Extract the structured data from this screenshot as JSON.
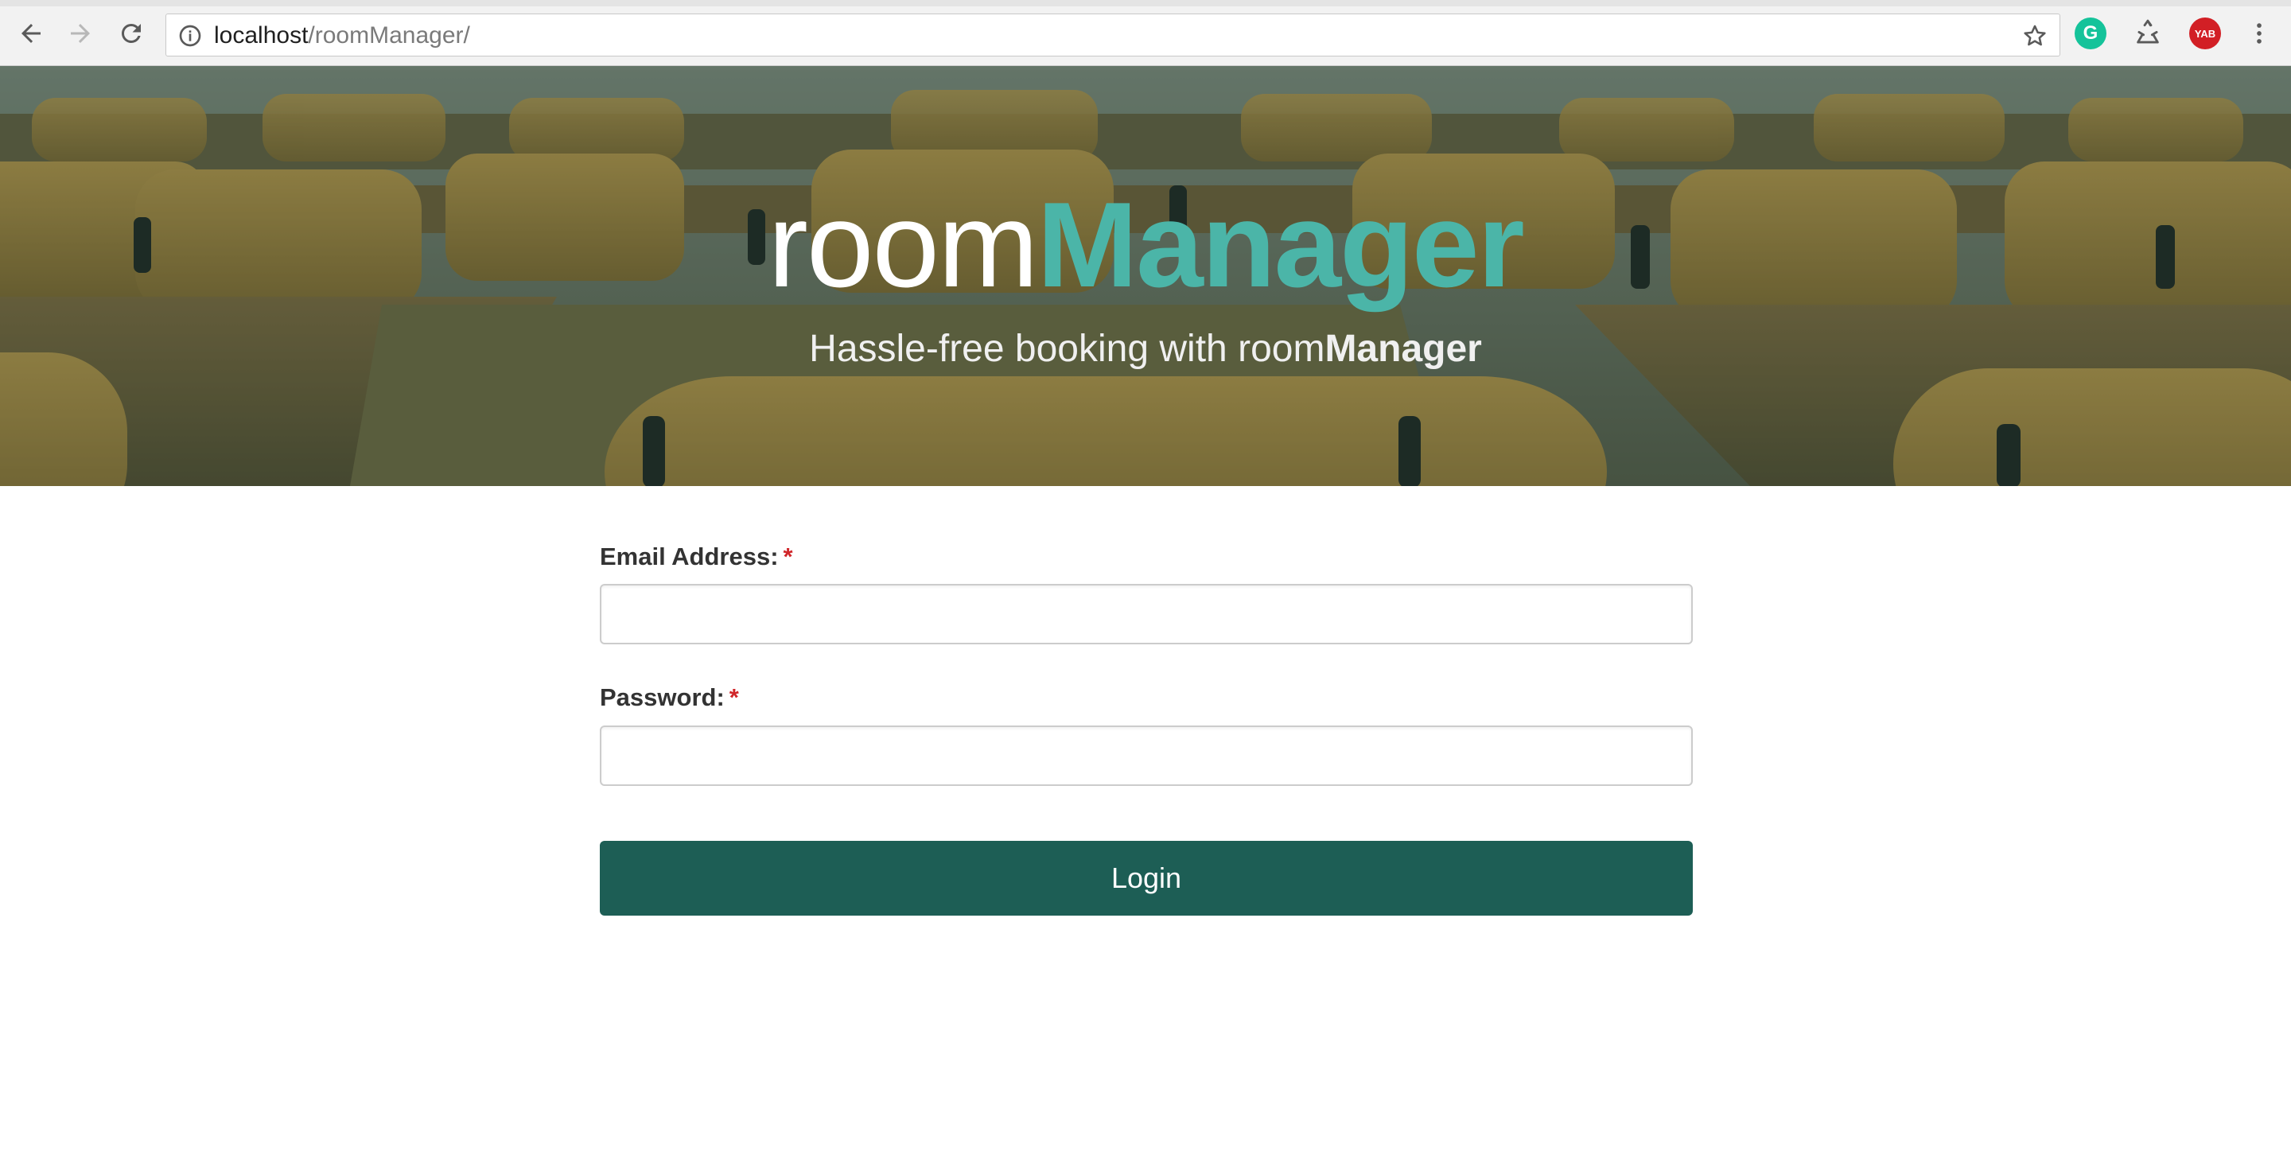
{
  "browser": {
    "url_host": "localhost",
    "url_path": "/roomManager/",
    "extensions": {
      "grammarly_letter": "G",
      "yab_label": "YAB"
    }
  },
  "hero": {
    "title_part1": "room",
    "title_part2": "Manager",
    "subtitle_part1": "Hassle-free booking with room",
    "subtitle_part2": "Manager"
  },
  "form": {
    "email_label": "Email Address:",
    "email_required": "*",
    "email_value": "",
    "password_label": "Password:",
    "password_required": "*",
    "password_value": "",
    "login_label": "Login"
  },
  "colors": {
    "accent": "#4bb5a8",
    "button": "#1d5e55",
    "required": "#d0262a"
  }
}
